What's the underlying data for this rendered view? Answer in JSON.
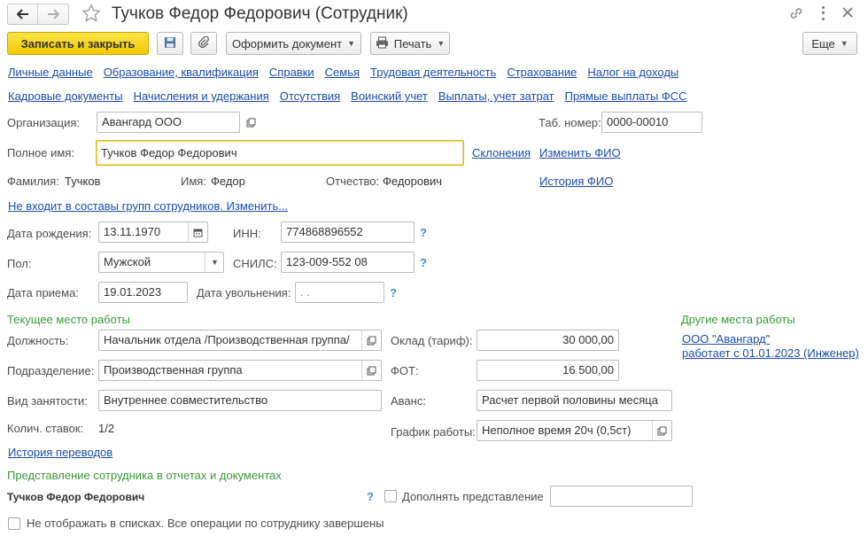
{
  "window": {
    "title": "Тучков Федор Федорович (Сотрудник)"
  },
  "toolbar": {
    "save_close": "Записать и закрыть",
    "create_doc": "Оформить документ",
    "print": "Печать",
    "more": "Еще"
  },
  "nav_links_row1": [
    "Личные данные",
    "Образование, квалификация",
    "Справки",
    "Семья",
    "Трудовая деятельность",
    "Страхование",
    "Налог на доходы"
  ],
  "nav_links_row2": [
    "Кадровые документы",
    "Начисления и удержания",
    "Отсутствия",
    "Воинский учет",
    "Выплаты, учет затрат",
    "Прямые выплаты ФСС"
  ],
  "form": {
    "org_label": "Организация:",
    "org_value": "Авангард ООО",
    "tab_label": "Таб. номер:",
    "tab_value": "0000-00010",
    "fullname_label": "Полное имя:",
    "fullname_value": "Тучков Федор Федорович",
    "declension_link": "Склонения",
    "change_fio_link": "Изменить ФИО",
    "surname_label": "Фамилия:",
    "surname_value": "Тучков",
    "name_label": "Имя:",
    "name_value": "Федор",
    "patronymic_label": "Отчество:",
    "patronymic_value": "Федорович",
    "fio_history_link": "История ФИО",
    "groups_link": "Не входит в составы групп сотрудников. Изменить...",
    "birth_label": "Дата рождения:",
    "birth_value": "13.11.1970",
    "inn_label": "ИНН:",
    "inn_value": "774868896552",
    "gender_label": "Пол:",
    "gender_value": "Мужской",
    "snils_label": "СНИЛС:",
    "snils_value": "123-009-552 08",
    "hire_label": "Дата приема:",
    "hire_value": "19.01.2023",
    "dismiss_label": "Дата увольнения:",
    "dismiss_value": " .  .",
    "help": "?"
  },
  "workplace": {
    "section_title": "Текущее место работы",
    "other_title": "Другие места работы",
    "other_org": "ООО \"Авангард\"",
    "other_since": "работает с 01.01.2023 (Инженер)",
    "position_label": "Должность:",
    "position_value": "Начальник отдела /Производственная группа/",
    "salary_label": "Оклад (тариф):",
    "salary_value": "30 000,00",
    "dept_label": "Подразделение:",
    "dept_value": "Производственная группа",
    "fot_label": "ФОТ:",
    "fot_value": "16 500,00",
    "emp_type_label": "Вид занятости:",
    "emp_type_value": "Внутреннее совместительство",
    "advance_label": "Аванс:",
    "advance_value": "Расчет первой половины месяца",
    "rates_label": "Колич. ставок:",
    "rates_value": "1/2",
    "schedule_label": "График работы:",
    "schedule_value": "Неполное время 20ч (0,5ст)",
    "transfers_link": "История переводов"
  },
  "representation": {
    "section_title": "Представление сотрудника в отчетах и документах",
    "name": "Тучков Федор Федорович",
    "supplement_label": "Дополнять представление",
    "supplement_value": "",
    "hide_label": "Не отображать в списках. Все операции по сотруднику завершены"
  }
}
